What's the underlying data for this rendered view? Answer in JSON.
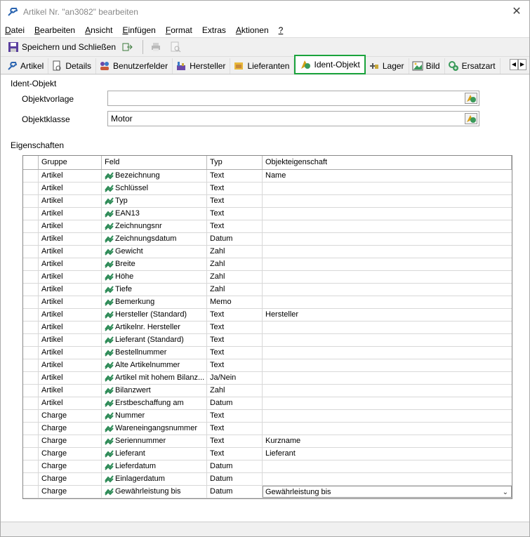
{
  "window": {
    "title": "Artikel Nr. \"an3082\" bearbeiten",
    "close_symbol": "✕"
  },
  "menu": [
    {
      "label": "Datei",
      "accel": "D",
      "rest": "atei"
    },
    {
      "label": "Bearbeiten",
      "accel": "B",
      "rest": "earbeiten"
    },
    {
      "label": "Ansicht",
      "accel": "A",
      "rest": "nsicht"
    },
    {
      "label": "Einfügen",
      "accel": "E",
      "rest": "infügen"
    },
    {
      "label": "Format",
      "accel": "F",
      "rest": "ormat"
    },
    {
      "label": "Extras",
      "accel": "",
      "rest": "Extras"
    },
    {
      "label": "Aktionen",
      "accel": "A",
      "rest": "ktionen"
    },
    {
      "label": "?",
      "accel": "?",
      "rest": ""
    }
  ],
  "toolbar": {
    "save_close_label": "Speichern und Schließen"
  },
  "tabs": [
    {
      "label": "Artikel",
      "icon": "wrench-icon"
    },
    {
      "label": "Details",
      "icon": "document-icon"
    },
    {
      "label": "Benutzerfelder",
      "icon": "users-icon"
    },
    {
      "label": "Hersteller",
      "icon": "factory-icon"
    },
    {
      "label": "Lieferanten",
      "icon": "supplier-icon"
    },
    {
      "label": "Ident-Objekt",
      "icon": "ident-object-icon",
      "active": true
    },
    {
      "label": "Lager",
      "icon": "storage-icon"
    },
    {
      "label": "Bild",
      "icon": "image-icon"
    },
    {
      "label": "Ersatzart",
      "icon": "replace-icon"
    }
  ],
  "ident": {
    "section_title": "Ident-Objekt",
    "vorlage_label": "Objektvorlage",
    "vorlage_value": "",
    "klasse_label": "Objektklasse",
    "klasse_value": "Motor"
  },
  "properties": {
    "section_title": "Eigenschaften",
    "columns": [
      "Gruppe",
      "Feld",
      "Typ",
      "Objekteigenschaft"
    ],
    "rows": [
      {
        "gruppe": "Artikel",
        "feld": "Bezeichnung",
        "typ": "Text",
        "prop": "Name"
      },
      {
        "gruppe": "Artikel",
        "feld": "Schlüssel",
        "typ": "Text",
        "prop": ""
      },
      {
        "gruppe": "Artikel",
        "feld": "Typ",
        "typ": "Text",
        "prop": ""
      },
      {
        "gruppe": "Artikel",
        "feld": "EAN13",
        "typ": "Text",
        "prop": ""
      },
      {
        "gruppe": "Artikel",
        "feld": "Zeichnungsnr",
        "typ": "Text",
        "prop": ""
      },
      {
        "gruppe": "Artikel",
        "feld": "Zeichnungsdatum",
        "typ": "Datum",
        "prop": ""
      },
      {
        "gruppe": "Artikel",
        "feld": "Gewicht",
        "typ": "Zahl",
        "prop": ""
      },
      {
        "gruppe": "Artikel",
        "feld": "Breite",
        "typ": "Zahl",
        "prop": ""
      },
      {
        "gruppe": "Artikel",
        "feld": "Höhe",
        "typ": "Zahl",
        "prop": ""
      },
      {
        "gruppe": "Artikel",
        "feld": "Tiefe",
        "typ": "Zahl",
        "prop": ""
      },
      {
        "gruppe": "Artikel",
        "feld": "Bemerkung",
        "typ": "Memo",
        "prop": ""
      },
      {
        "gruppe": "Artikel",
        "feld": "Hersteller (Standard)",
        "typ": "Text",
        "prop": "Hersteller"
      },
      {
        "gruppe": "Artikel",
        "feld": "Artikelnr. Hersteller",
        "typ": "Text",
        "prop": ""
      },
      {
        "gruppe": "Artikel",
        "feld": "Lieferant (Standard)",
        "typ": "Text",
        "prop": ""
      },
      {
        "gruppe": "Artikel",
        "feld": "Bestellnummer",
        "typ": "Text",
        "prop": ""
      },
      {
        "gruppe": "Artikel",
        "feld": "Alte Artikelnummer",
        "typ": "Text",
        "prop": ""
      },
      {
        "gruppe": "Artikel",
        "feld": "Artikel mit  hohem Bilanz...",
        "typ": "Ja/Nein",
        "prop": ""
      },
      {
        "gruppe": "Artikel",
        "feld": "Bilanzwert",
        "typ": "Zahl",
        "prop": ""
      },
      {
        "gruppe": "Artikel",
        "feld": "Erstbeschaffung am",
        "typ": "Datum",
        "prop": ""
      },
      {
        "gruppe": "Charge",
        "feld": "Nummer",
        "typ": "Text",
        "prop": ""
      },
      {
        "gruppe": "Charge",
        "feld": "Wareneingangsnummer",
        "typ": "Text",
        "prop": ""
      },
      {
        "gruppe": "Charge",
        "feld": "Seriennummer",
        "typ": "Text",
        "prop": "Kurzname"
      },
      {
        "gruppe": "Charge",
        "feld": "Lieferant",
        "typ": "Text",
        "prop": "Lieferant"
      },
      {
        "gruppe": "Charge",
        "feld": "Lieferdatum",
        "typ": "Datum",
        "prop": ""
      },
      {
        "gruppe": "Charge",
        "feld": "Einlagerdatum",
        "typ": "Datum",
        "prop": ""
      },
      {
        "gruppe": "Charge",
        "feld": "Gewährleistung bis",
        "typ": "Datum",
        "prop": "Gewährleistung bis",
        "combo": true
      }
    ]
  },
  "colors": {
    "active_tab_border": "#1aa33c",
    "field_icon_green": "#2e8b57"
  }
}
